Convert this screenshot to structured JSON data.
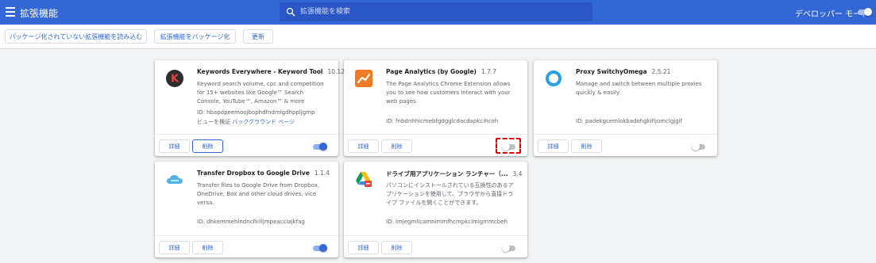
{
  "header": {
    "title": "拡張機能",
    "search_placeholder": "拡張機能を検索",
    "devmode_label": "デベロッパー モード",
    "devmode_on": true,
    "color": "#3367d6"
  },
  "toolbar": {
    "load_unpacked": "パッケージ化されていない拡張機能を読み込む",
    "pack": "拡張機能をパッケージ化",
    "update": "更新"
  },
  "cards": [
    {
      "name": "Keywords Everywhere - Keyword Tool",
      "version": "10.12",
      "description": "Keyword search volume, cpc and competition for 15+ websites like Google™ Search Console, YouTube™, Amazon™ & more",
      "id": "ID: hbapdpeemoojbophdfndmlgdhppljgmp",
      "view_prefix": "ビューを検証",
      "view_link": "バックグラウンド ページ",
      "details": "詳細",
      "remove": "削除",
      "enabled": true,
      "icon": "keywords-everywhere-icon"
    },
    {
      "name": "Page Analytics (by Google)",
      "version": "1.7.7",
      "description": "The Page Analytics Chrome Extension allows you to see how customers interact with your web pages.",
      "id": "ID: fnbdnhhicmebfgdgglcdacdapkcihcoh",
      "details": "詳細",
      "remove": "削除",
      "enabled": false,
      "icon": "page-analytics-icon"
    },
    {
      "name": "Proxy SwitchyOmega",
      "version": "2.5.21",
      "description": "Manage and switch between multiple proxies quickly & easily.",
      "id": "ID: padekgcemlokbadohgkifijomclgjgif",
      "details": "詳細",
      "remove": "削除",
      "enabled": false,
      "icon": "switchyomega-icon"
    },
    {
      "name": "Transfer Dropbox to Google Drive",
      "version": "1.1.4",
      "description": "Transfer files to Google Drive from Dropbox, OneDrive, Box and other cloud drives, vice versa.",
      "id": "ID: dhkemmehlndncfkilljmpeacciajkfag",
      "details": "詳細",
      "remove": "削除",
      "enabled": true,
      "icon": "cloud-icon"
    },
    {
      "name": "ドライブ用アプリケーション ランチャー（...",
      "version": "3.4",
      "description": "パソコンにインストールされている互換性のあるアプリケーションを使用して、ブラウザから直接ドライブ ファイルを開くことができます。",
      "id": "ID: lmjegmlicamnimmfhcmpkclmigmmcbeh",
      "details": "詳細",
      "remove": "削除",
      "enabled": false,
      "icon": "drive-launcher-icon"
    }
  ]
}
